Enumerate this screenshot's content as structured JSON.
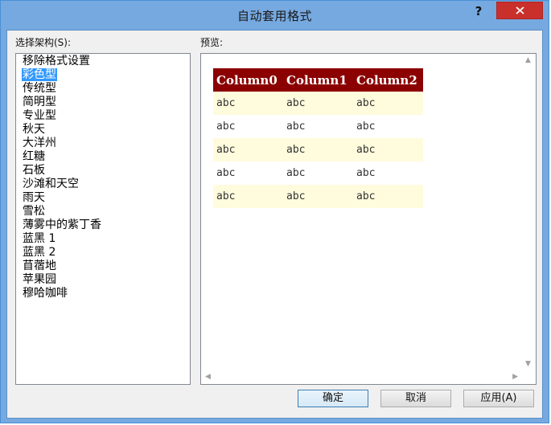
{
  "window": {
    "title": "自动套用格式",
    "help_label": "?"
  },
  "scheme": {
    "label": "选择架构(S):",
    "items": [
      "移除格式设置",
      "彩色型",
      "传统型",
      "简明型",
      "专业型",
      "秋天",
      "大洋州",
      "红糖",
      "石板",
      "沙滩和天空",
      "雨天",
      "雪松",
      "薄雾中的紫丁香",
      "蓝黑 1",
      "蓝黑 2",
      "苜蓿地",
      "苹果园",
      "穆哈咖啡"
    ],
    "selected": "彩色型"
  },
  "preview": {
    "label": "预览:",
    "table": {
      "headers": [
        "Column0",
        "Column1",
        "Column2"
      ],
      "rows": [
        [
          "abc",
          "abc",
          "abc"
        ],
        [
          "abc",
          "abc",
          "abc"
        ],
        [
          "abc",
          "abc",
          "abc"
        ],
        [
          "abc",
          "abc",
          "abc"
        ],
        [
          "abc",
          "abc",
          "abc"
        ]
      ]
    }
  },
  "buttons": {
    "ok": "确定",
    "cancel": "取消",
    "apply": "应用(A)"
  },
  "colors": {
    "header_bg": "#8b0000",
    "band_bg": "#fffbdd",
    "selection": "#3399ff",
    "close_button": "#c9302c"
  },
  "icons": {
    "close": "close-icon",
    "scroll_up": "scroll-up-icon",
    "scroll_down": "scroll-down-icon",
    "scroll_left": "scroll-left-icon",
    "scroll_right": "scroll-right-icon"
  }
}
